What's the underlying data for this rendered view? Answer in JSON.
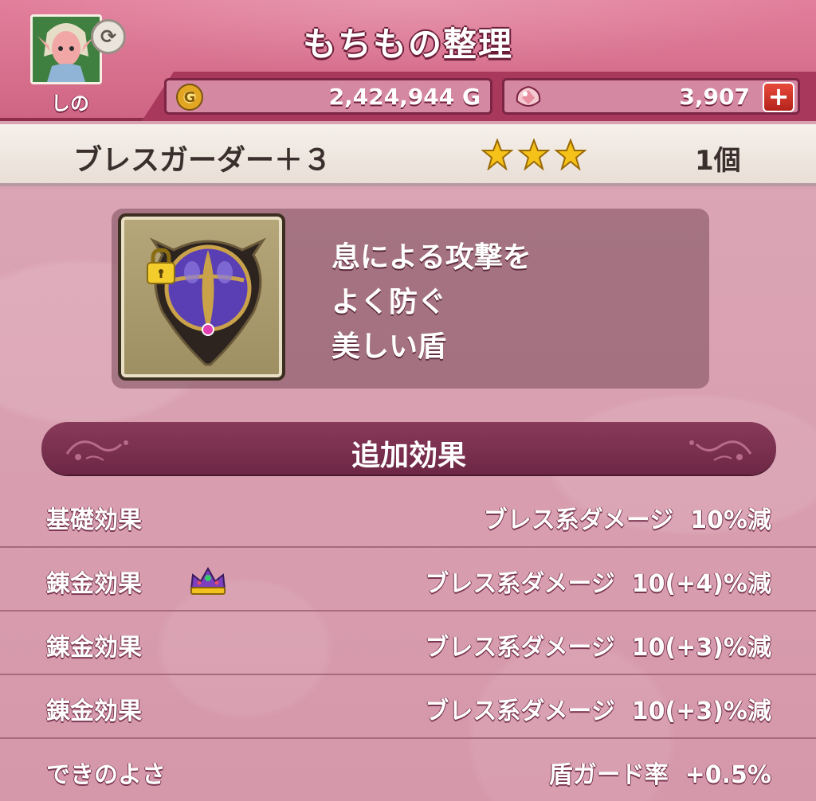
{
  "header": {
    "title": "もちもの整理",
    "player_name": "しの",
    "gold_value": "2,424,944 G",
    "gold_icon_letter": "G",
    "gem_value": "3,907",
    "add_label": "+"
  },
  "item": {
    "name": "ブレスガーダー＋３",
    "stars": 3,
    "count": "1個",
    "icon": "breath-guarder-shield",
    "locked": true,
    "description": [
      "息による攻撃を",
      "よく防ぐ",
      "美しい盾"
    ]
  },
  "effects": {
    "title": "追加効果",
    "rows": [
      {
        "label": "基礎効果",
        "value": "ブレス系ダメージ  10%減",
        "crown": false
      },
      {
        "label": "錬金効果",
        "value": "ブレス系ダメージ  10(+4)%減",
        "crown": true
      },
      {
        "label": "錬金効果",
        "value": "ブレス系ダメージ  10(+3)%減",
        "crown": false
      },
      {
        "label": "錬金効果",
        "value": "ブレス系ダメージ  10(+3)%減",
        "crown": false
      },
      {
        "label": "できのよさ",
        "value": "盾ガード率  +0.5%",
        "crown": false
      }
    ]
  },
  "colors": {
    "header_pink": "#e27f9c",
    "body_pink": "#dba5b5",
    "banner_dark": "#7a2e4e",
    "star_gold": "#f5c21a"
  }
}
